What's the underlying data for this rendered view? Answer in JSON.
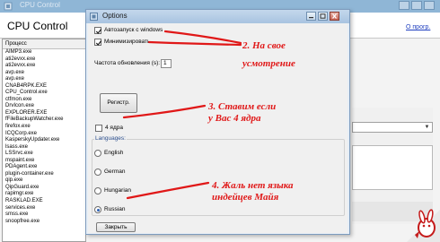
{
  "background_app": {
    "titlebar_text": "CPU Control",
    "app_name": "CPU Control",
    "about_link": "О прогр.",
    "process_header": "Процесс",
    "processes": [
      "AIMP3.exe",
      "ati2evxx.exe",
      "ati2evxx.exe",
      "avp.exe",
      "avp.exe",
      "CNAB4RPK.EXE",
      "CPU_Control.exe",
      "ctfmon.exe",
      "DrvIcon.exe",
      "EXPLORER.EXE",
      "fFileBackupWatcher.exe",
      "firefox.exe",
      "ICQCorp.exe",
      "KasperskyUpdater.exe",
      "lsass.exe",
      "LSSrvc.exe",
      "mspaint.exe",
      "PDAgent.exe",
      "plugin-container.exe",
      "qip.exe",
      "QipGuard.exe",
      "rapimgr.exe",
      "RASKLAD.EXE",
      "services.exe",
      "smss.exe",
      "snoopfree.exe"
    ]
  },
  "dialog": {
    "title": "Options",
    "autostart_label": "Автозапуск с windows",
    "autostart_checked": true,
    "minimize_label": "Минимизировать",
    "minimize_checked": true,
    "refresh_rate_label": "Частота обновления (s):",
    "refresh_rate_value": "1",
    "register_button": "Регистр.",
    "four_cores_label": "4 ядра",
    "four_cores_checked": false,
    "languages_label": "Languages:",
    "languages": [
      {
        "label": "English",
        "selected": false
      },
      {
        "label": "German",
        "selected": false
      },
      {
        "label": "Hungarian",
        "selected": false
      },
      {
        "label": "Russian",
        "selected": true
      }
    ],
    "close_button": "Закрыть"
  },
  "annotations": {
    "note2_line1": "2. На свое",
    "note2_line2": "усмотрение",
    "note3_line1": "3. Ставим если",
    "note3_line2": "у Вас 4 ядра",
    "note4_line1": "4. Жаль нет  языка",
    "note4_line2": "индейцев Майя"
  },
  "colors": {
    "annotation_red": "#e01818",
    "dialog_border": "#7d9bbd",
    "languages_label": "#2a4d8c"
  }
}
